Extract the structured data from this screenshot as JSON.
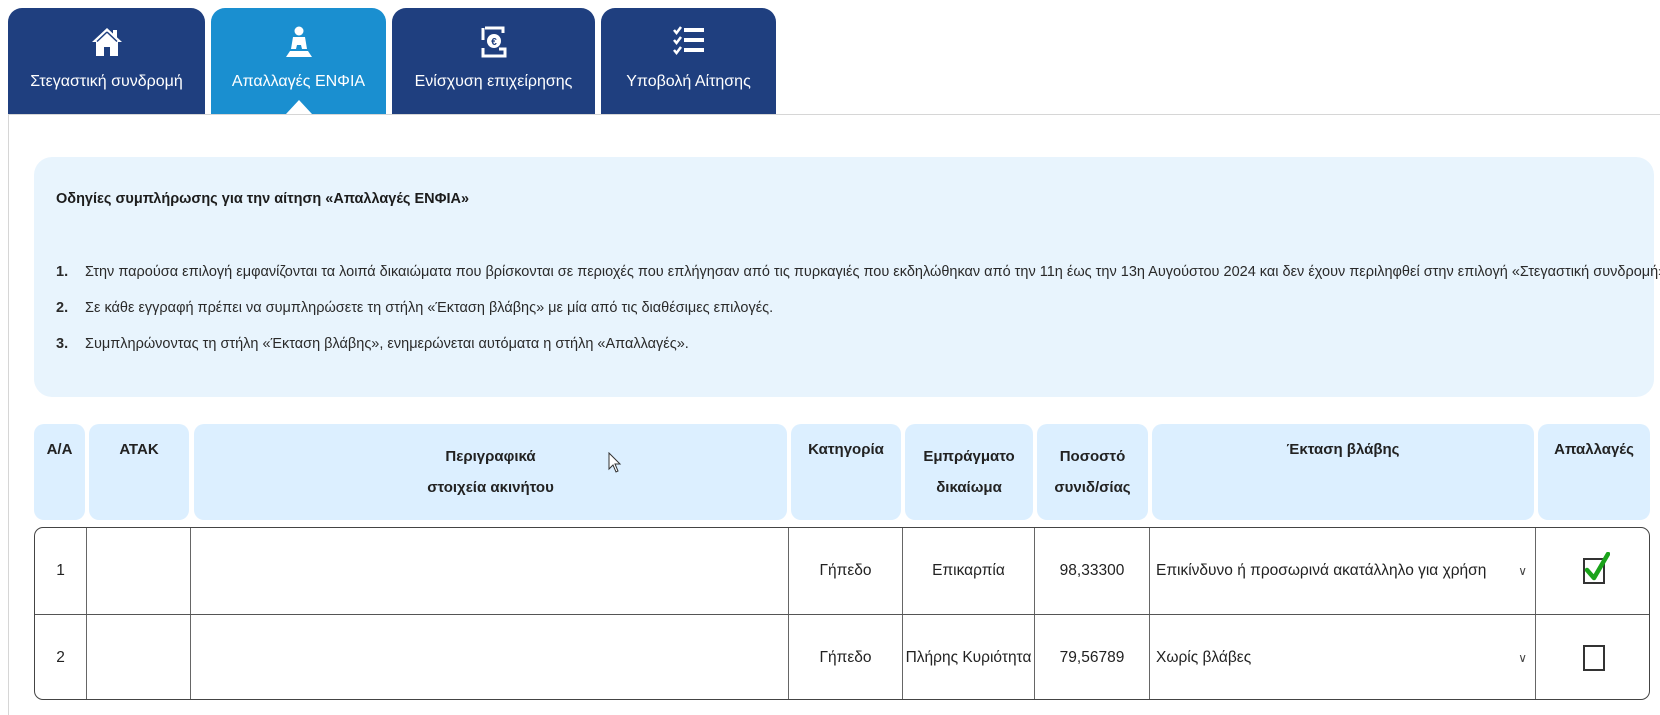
{
  "tabs": [
    {
      "label": "Στεγαστική συνδρομή",
      "icon": "home-icon",
      "active": false
    },
    {
      "label": "Απαλλαγές ΕΝΦΙΑ",
      "icon": "person-landscape-icon",
      "active": true
    },
    {
      "label": "Ενίσχυση επιχείρησης",
      "icon": "hand-coin-icon",
      "active": false
    },
    {
      "label": "Υποβολή Αίτησης",
      "icon": "checklist-icon",
      "active": false
    }
  ],
  "instructions": {
    "title": "Οδηγίες συμπλήρωσης για την αίτηση «Απαλλαγές ΕΝΦΙΑ»",
    "items": [
      {
        "num": "1.",
        "text": "Στην παρούσα επιλογή εμφανίζονται τα λοιπά δικαιώματα που βρίσκονται σε περιοχές που επλήγησαν από τις πυρκαγιές που εκδηλώθηκαν από την 11η έως την 13η Αυγούστου 2024 και δεν έχουν περιληφθεί στην επιλογή «Στεγαστική συνδρομή»."
      },
      {
        "num": "2.",
        "text": "Σε κάθε εγγραφή πρέπει να συμπληρώσετε τη στήλη «Έκταση βλάβης» με μία από τις διαθέσιμες επιλογές."
      },
      {
        "num": "3.",
        "text": "Συμπληρώνοντας τη στήλη «Έκταση βλάβης», ενημερώνεται αυτόματα η στήλη «Απαλλαγές»."
      }
    ]
  },
  "table": {
    "headers": {
      "aa": "Α/Α",
      "atak": "ΑΤΑΚ",
      "desc_line1": "Περιγραφικά",
      "desc_line2": "στοιχεία ακινήτου",
      "category": "Κατηγορία",
      "right_line1": "Εμπράγματο",
      "right_line2": "δικαίωμα",
      "pct_line1": "Ποσοστό",
      "pct_line2": "συνιδ/σίας",
      "damage": "Έκταση βλάβης",
      "exemptions": "Απαλλαγές"
    },
    "rows": [
      {
        "aa": "1",
        "atak": "",
        "desc": "",
        "category": "Γήπεδο",
        "right": "Επικαρπία",
        "pct": "98,33300",
        "damage": "Επικίνδυνο ή προσωρινά ακατάλληλο για χρήση",
        "exempt": true
      },
      {
        "aa": "2",
        "atak": "",
        "desc": "",
        "category": "Γήπεδο",
        "right": "Πλήρης Κυριότητα",
        "pct": "79,56789",
        "damage": "Χωρίς βλάβες",
        "exempt": false
      }
    ]
  },
  "colors": {
    "tab": "#1f3f7f",
    "tab_active": "#1a8fd0",
    "info_bg": "#e8f4fd",
    "header_bg": "#dcefff",
    "check": "#1aa31a"
  }
}
